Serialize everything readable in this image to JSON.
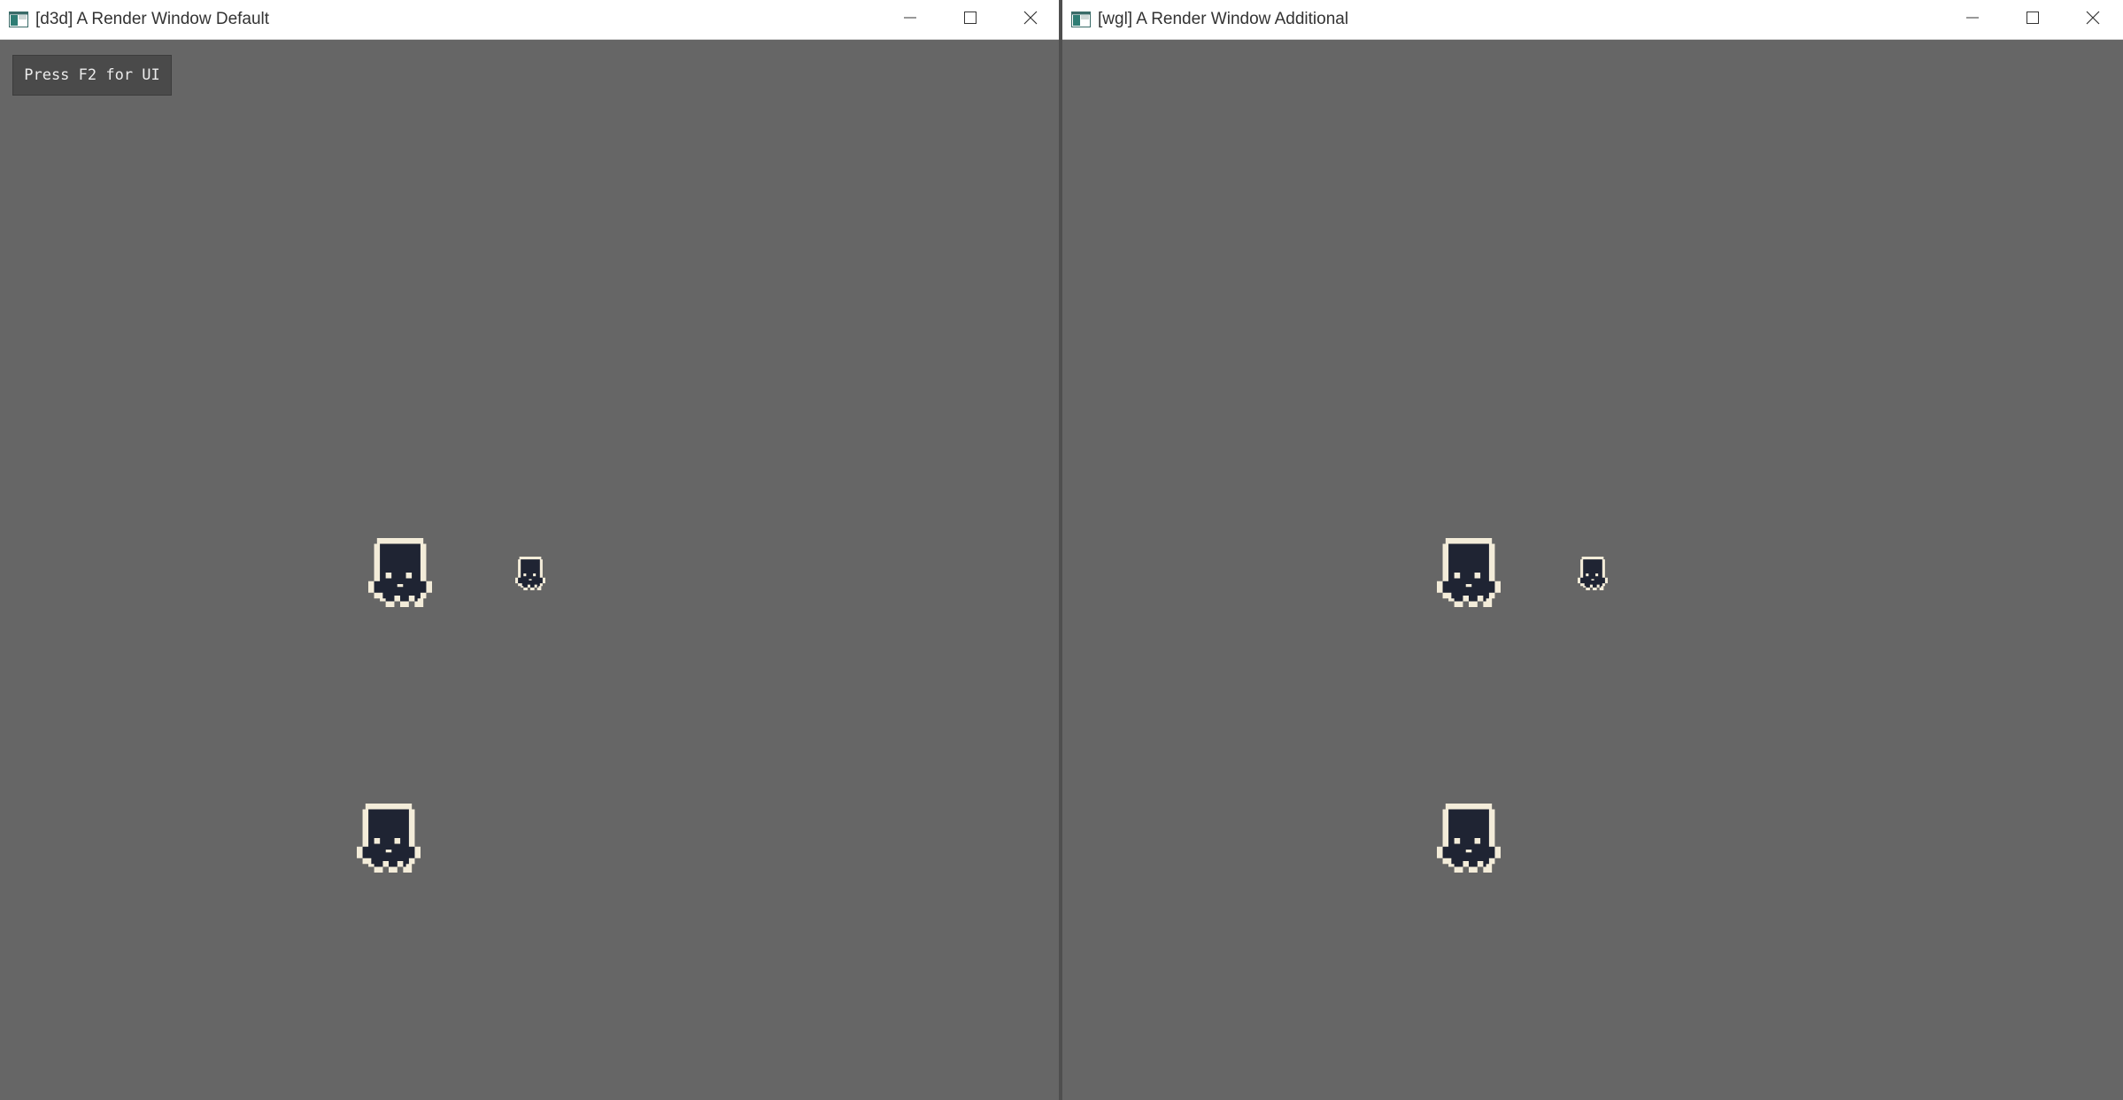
{
  "windows": [
    {
      "id": "left",
      "title": "[d3d] A Render Window Default",
      "hint": "Press F2 for UI",
      "sprites": [
        "character-sprite",
        "character-sprite-small",
        "character-sprite"
      ]
    },
    {
      "id": "right",
      "title": "[wgl] A Render Window Additional",
      "sprites": [
        "character-sprite",
        "character-sprite-small",
        "character-sprite"
      ]
    }
  ],
  "icons": {
    "app": "app-window-icon",
    "minimize": "minimize-icon",
    "maximize": "maximize-icon",
    "close": "close-icon"
  },
  "colors": {
    "viewport_background": "#666666",
    "titlebar": "#ffffff",
    "sprite_body": "#1f2433",
    "sprite_outline": "#f3ecd9"
  }
}
